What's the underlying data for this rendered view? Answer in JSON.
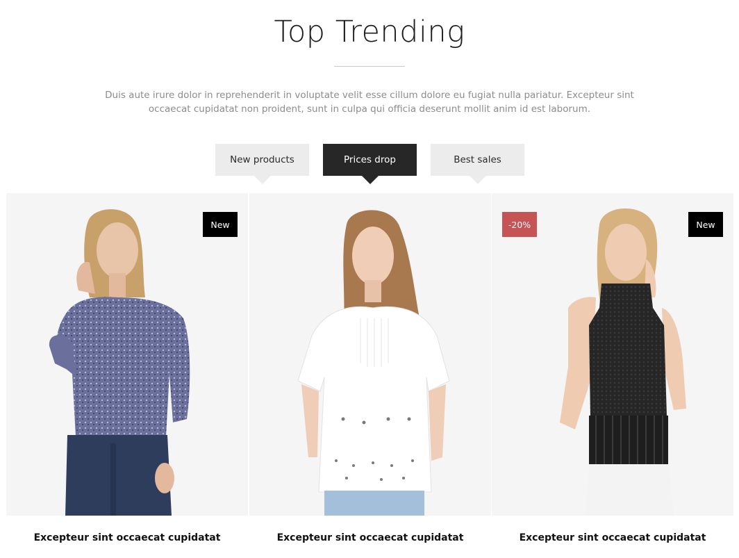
{
  "section": {
    "title": "Top Trending",
    "description": "Duis aute irure dolor in reprehenderit in voluptate velit esse cillum dolore eu fugiat nulla pariatur. Excepteur sint occaecat cupidatat non proident, sunt in culpa qui officia deserunt mollit anim id est laborum."
  },
  "tabs": [
    {
      "label": "New products",
      "active": false
    },
    {
      "label": "Prices drop",
      "active": true
    },
    {
      "label": "Best sales",
      "active": false
    }
  ],
  "products": [
    {
      "name": "Excepteur sint occaecat cupidatat",
      "badges": {
        "new": "New"
      },
      "image": "woman-in-printed-blouse-and-jeans"
    },
    {
      "name": "Excepteur sint occaecat cupidatat",
      "badges": {},
      "image": "woman-in-white-eyelet-top"
    },
    {
      "name": "Excepteur sint occaecat cupidatat",
      "badges": {
        "sale": "-20%",
        "new": "New"
      },
      "image": "woman-in-black-knit-sleeveless-top"
    }
  ],
  "colors": {
    "active_tab": "#272727",
    "inactive_tab": "#ececec",
    "sale_badge": "#c75455",
    "new_badge": "#000000",
    "card_bg": "#f5f5f6"
  }
}
